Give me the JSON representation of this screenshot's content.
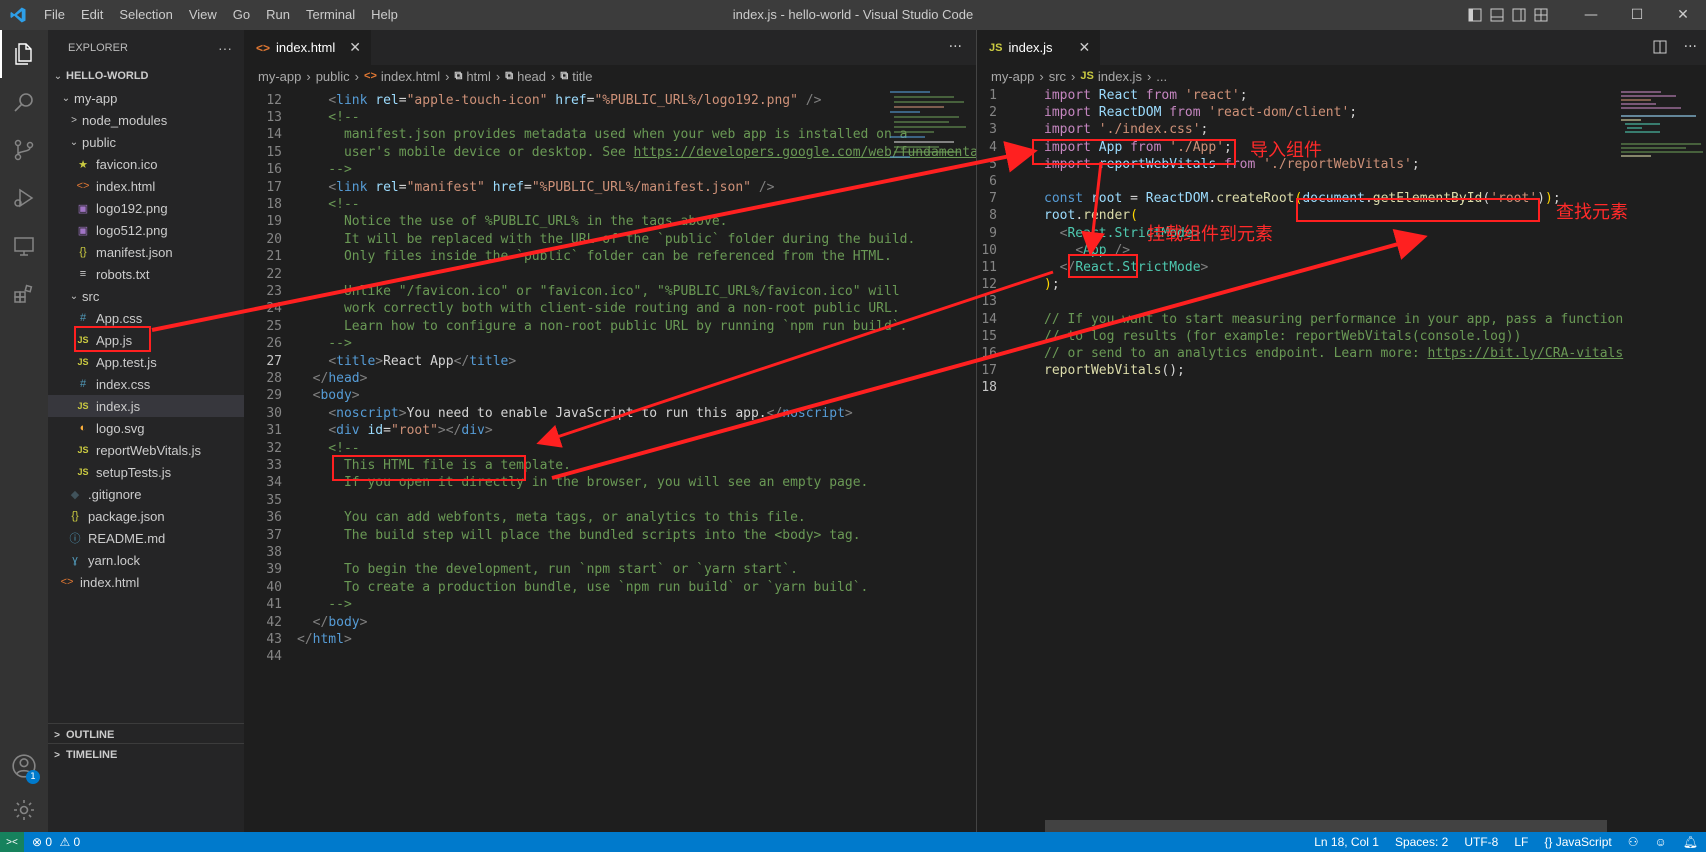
{
  "window": {
    "title": "index.js - hello-world - Visual Studio Code",
    "menu": [
      "File",
      "Edit",
      "Selection",
      "View",
      "Go",
      "Run",
      "Terminal",
      "Help"
    ],
    "controls": {
      "minimize": "—",
      "maximize": "☐",
      "close": "✕"
    }
  },
  "activity_bar": [
    "explorer-icon",
    "search-icon",
    "source-control-icon",
    "run-debug-icon",
    "remote-explorer-icon",
    "extensions-icon"
  ],
  "sidebar": {
    "header": "EXPLORER",
    "more": "···",
    "root": "HELLO-WORLD",
    "tree": [
      {
        "label": "my-app",
        "kind": "folder-open",
        "indent": 1
      },
      {
        "label": "node_modules",
        "kind": "folder-closed",
        "indent": 2
      },
      {
        "label": "public",
        "kind": "folder-open",
        "indent": 2
      },
      {
        "label": "favicon.ico",
        "kind": "star",
        "indent": 3
      },
      {
        "label": "index.html",
        "kind": "html",
        "indent": 3
      },
      {
        "label": "logo192.png",
        "kind": "image",
        "indent": 3
      },
      {
        "label": "logo512.png",
        "kind": "image",
        "indent": 3
      },
      {
        "label": "manifest.json",
        "kind": "json",
        "indent": 3
      },
      {
        "label": "robots.txt",
        "kind": "text",
        "indent": 3
      },
      {
        "label": "src",
        "kind": "folder-open",
        "indent": 2
      },
      {
        "label": "App.css",
        "kind": "css",
        "indent": 3
      },
      {
        "label": "App.js",
        "kind": "js",
        "indent": 3
      },
      {
        "label": "App.test.js",
        "kind": "js",
        "indent": 3
      },
      {
        "label": "index.css",
        "kind": "css",
        "indent": 3
      },
      {
        "label": "index.js",
        "kind": "js",
        "indent": 3,
        "selected": true
      },
      {
        "label": "logo.svg",
        "kind": "svg",
        "indent": 3
      },
      {
        "label": "reportWebVitals.js",
        "kind": "js",
        "indent": 3
      },
      {
        "label": "setupTests.js",
        "kind": "js",
        "indent": 3
      },
      {
        "label": ".gitignore",
        "kind": "git",
        "indent": 2
      },
      {
        "label": "package.json",
        "kind": "json",
        "indent": 2
      },
      {
        "label": "README.md",
        "kind": "info",
        "indent": 2
      },
      {
        "label": "yarn.lock",
        "kind": "yarn",
        "indent": 2
      },
      {
        "label": "index.html",
        "kind": "html",
        "indent": 1
      }
    ],
    "outline": "OUTLINE",
    "timeline": "TIMELINE",
    "account_badge": "1"
  },
  "left_editor": {
    "tab": "index.html",
    "tab_close": "✕",
    "more": "···",
    "breadcrumb": [
      "my-app",
      "public",
      "index.html",
      "html",
      "head",
      "title"
    ],
    "lines": [
      {
        "n": "12",
        "t": [
          [
            "    ",
            ""
          ],
          [
            "<",
            "pun"
          ],
          [
            "link",
            "tag"
          ],
          [
            " rel",
            "attr"
          ],
          [
            "=",
            ""
          ],
          [
            "\"apple-touch-icon\"",
            "str"
          ],
          [
            " href",
            "attr"
          ],
          [
            "=",
            ""
          ],
          [
            "\"%PUBLIC_URL%/logo192.png\"",
            "str"
          ],
          [
            " />",
            "pun"
          ]
        ]
      },
      {
        "n": "13",
        "t": [
          [
            "    <!--",
            "com"
          ]
        ]
      },
      {
        "n": "14",
        "t": [
          [
            "      manifest.json provides metadata used when your web app is installed on a",
            "com"
          ]
        ]
      },
      {
        "n": "15",
        "t": [
          [
            "      user's mobile device or desktop. See ",
            "com"
          ],
          [
            "https://developers.google.com/web/fundamentals/web-app-manifest/",
            "link"
          ]
        ]
      },
      {
        "n": "16",
        "t": [
          [
            "    -->",
            "com"
          ]
        ]
      },
      {
        "n": "17",
        "t": [
          [
            "    ",
            ""
          ],
          [
            "<",
            "pun"
          ],
          [
            "link",
            "tag"
          ],
          [
            " rel",
            "attr"
          ],
          [
            "=",
            ""
          ],
          [
            "\"manifest\"",
            "str"
          ],
          [
            " href",
            "attr"
          ],
          [
            "=",
            ""
          ],
          [
            "\"%PUBLIC_URL%/manifest.json\"",
            "str"
          ],
          [
            " />",
            "pun"
          ]
        ]
      },
      {
        "n": "18",
        "t": [
          [
            "    <!--",
            "com"
          ]
        ]
      },
      {
        "n": "19",
        "t": [
          [
            "      Notice the use of %PUBLIC_URL% in the tags above.",
            "com"
          ]
        ]
      },
      {
        "n": "20",
        "t": [
          [
            "      It will be replaced with the URL of the `public` folder during the build.",
            "com"
          ]
        ]
      },
      {
        "n": "21",
        "t": [
          [
            "      Only files inside the `public` folder can be referenced from the HTML.",
            "com"
          ]
        ]
      },
      {
        "n": "22",
        "t": [
          [
            "",
            ""
          ]
        ]
      },
      {
        "n": "23",
        "t": [
          [
            "      Unlike \"/favicon.ico\" or \"favicon.ico\", \"%PUBLIC_URL%/favicon.ico\" will",
            "com"
          ]
        ]
      },
      {
        "n": "24",
        "t": [
          [
            "      work correctly both with client-side routing and a non-root public URL.",
            "com"
          ]
        ]
      },
      {
        "n": "25",
        "t": [
          [
            "      Learn how to configure a non-root public URL by running `npm run build`.",
            "com"
          ]
        ]
      },
      {
        "n": "26",
        "t": [
          [
            "    -->",
            "com"
          ]
        ]
      },
      {
        "n": "27",
        "t": [
          [
            "    ",
            ""
          ],
          [
            "<",
            "pun"
          ],
          [
            "title",
            "tag"
          ],
          [
            ">",
            "pun"
          ],
          [
            "React App",
            ""
          ],
          [
            "</",
            "pun"
          ],
          [
            "title",
            "tag"
          ],
          [
            ">",
            "pun"
          ]
        ],
        "cur": true
      },
      {
        "n": "28",
        "t": [
          [
            "  ",
            ""
          ],
          [
            "</",
            "pun"
          ],
          [
            "head",
            "tag"
          ],
          [
            ">",
            "pun"
          ]
        ]
      },
      {
        "n": "29",
        "t": [
          [
            "  ",
            ""
          ],
          [
            "<",
            "pun"
          ],
          [
            "body",
            "tag"
          ],
          [
            ">",
            "pun"
          ]
        ]
      },
      {
        "n": "30",
        "t": [
          [
            "    ",
            ""
          ],
          [
            "<",
            "pun"
          ],
          [
            "noscript",
            "tag"
          ],
          [
            ">",
            "pun"
          ],
          [
            "You need to enable JavaScript to run this app.",
            ""
          ],
          [
            "</",
            "pun"
          ],
          [
            "noscript",
            "tag"
          ],
          [
            ">",
            "pun"
          ]
        ]
      },
      {
        "n": "31",
        "t": [
          [
            "    ",
            ""
          ],
          [
            "<",
            "pun"
          ],
          [
            "div",
            "tag"
          ],
          [
            " id",
            "attr"
          ],
          [
            "=",
            ""
          ],
          [
            "\"root\"",
            "str"
          ],
          [
            ">",
            "pun"
          ],
          [
            "</",
            "pun"
          ],
          [
            "div",
            "tag"
          ],
          [
            ">",
            "pun"
          ]
        ]
      },
      {
        "n": "32",
        "t": [
          [
            "    <!--",
            "com"
          ]
        ]
      },
      {
        "n": "33",
        "t": [
          [
            "      This HTML file is a template.",
            "com"
          ]
        ]
      },
      {
        "n": "34",
        "t": [
          [
            "      If you open it directly in the browser, you will see an empty page.",
            "com"
          ]
        ]
      },
      {
        "n": "35",
        "t": [
          [
            "",
            ""
          ]
        ]
      },
      {
        "n": "36",
        "t": [
          [
            "      You can add webfonts, meta tags, or analytics to this file.",
            "com"
          ]
        ]
      },
      {
        "n": "37",
        "t": [
          [
            "      The build step will place the bundled scripts into the <body> tag.",
            "com"
          ]
        ]
      },
      {
        "n": "38",
        "t": [
          [
            "",
            ""
          ]
        ]
      },
      {
        "n": "39",
        "t": [
          [
            "      To begin the development, run `npm start` or `yarn start`.",
            "com"
          ]
        ]
      },
      {
        "n": "40",
        "t": [
          [
            "      To create a production bundle, use `npm run build` or `yarn build`.",
            "com"
          ]
        ]
      },
      {
        "n": "41",
        "t": [
          [
            "    -->",
            "com"
          ]
        ]
      },
      {
        "n": "42",
        "t": [
          [
            "  ",
            ""
          ],
          [
            "</",
            "pun"
          ],
          [
            "body",
            "tag"
          ],
          [
            ">",
            "pun"
          ]
        ]
      },
      {
        "n": "43",
        "t": [
          [
            "",
            ""
          ],
          [
            "</",
            "pun"
          ],
          [
            "html",
            "tag"
          ],
          [
            ">",
            "pun"
          ]
        ]
      },
      {
        "n": "44",
        "t": [
          [
            "",
            ""
          ]
        ]
      }
    ]
  },
  "right_editor": {
    "tab": "index.js",
    "tab_close": "✕",
    "more": "···",
    "breadcrumb": [
      "my-app",
      "src",
      "index.js",
      "..."
    ],
    "lines": [
      {
        "n": "1",
        "t": [
          [
            "import",
            "kw"
          ],
          [
            " React ",
            "var"
          ],
          [
            "from",
            "kw"
          ],
          [
            " 'react'",
            "str"
          ],
          [
            ";",
            ""
          ]
        ]
      },
      {
        "n": "2",
        "t": [
          [
            "import",
            "kw"
          ],
          [
            " ReactDOM ",
            "var"
          ],
          [
            "from",
            "kw"
          ],
          [
            " 'react-dom/client'",
            "str"
          ],
          [
            ";",
            ""
          ]
        ]
      },
      {
        "n": "3",
        "t": [
          [
            "import",
            "kw"
          ],
          [
            " './index.css'",
            "str"
          ],
          [
            ";",
            ""
          ]
        ]
      },
      {
        "n": "4",
        "t": [
          [
            "import",
            "kw"
          ],
          [
            " App ",
            "var"
          ],
          [
            "from",
            "kw"
          ],
          [
            " './App'",
            "str"
          ],
          [
            ";",
            ""
          ]
        ]
      },
      {
        "n": "5",
        "t": [
          [
            "import",
            "kw"
          ],
          [
            " reportWebVitals ",
            "var"
          ],
          [
            "from",
            "kw"
          ],
          [
            " './reportWebVitals'",
            "str"
          ],
          [
            ";",
            ""
          ]
        ]
      },
      {
        "n": "6",
        "t": [
          [
            "",
            ""
          ]
        ]
      },
      {
        "n": "7",
        "t": [
          [
            "const",
            "dec"
          ],
          [
            " root ",
            "var"
          ],
          [
            "= ",
            ""
          ],
          [
            "ReactDOM",
            "var"
          ],
          [
            ".",
            ""
          ],
          [
            "createRoot",
            "fn"
          ],
          [
            "(",
            "brk"
          ],
          [
            "document",
            "var"
          ],
          [
            ".",
            ""
          ],
          [
            "getElementById",
            "fn"
          ],
          [
            "(",
            ""
          ],
          [
            "'root'",
            "str"
          ],
          [
            ")",
            ""
          ],
          [
            ")",
            "brk"
          ],
          [
            ";",
            ""
          ]
        ]
      },
      {
        "n": "8",
        "t": [
          [
            "root",
            "var"
          ],
          [
            ".",
            ""
          ],
          [
            "render",
            "fn"
          ],
          [
            "(",
            "brk"
          ]
        ]
      },
      {
        "n": "9",
        "t": [
          [
            "  ",
            ""
          ],
          [
            "<",
            "pun"
          ],
          [
            "React.StrictMode",
            "cls"
          ],
          [
            ">",
            "pun"
          ]
        ]
      },
      {
        "n": "10",
        "t": [
          [
            "    ",
            ""
          ],
          [
            "<",
            "pun"
          ],
          [
            "App",
            "cls"
          ],
          [
            " />",
            "pun"
          ]
        ]
      },
      {
        "n": "11",
        "t": [
          [
            "  ",
            ""
          ],
          [
            "</",
            "pun"
          ],
          [
            "React.StrictMode",
            "cls"
          ],
          [
            ">",
            "pun"
          ]
        ]
      },
      {
        "n": "12",
        "t": [
          [
            ")",
            "brk"
          ],
          [
            ";",
            ""
          ]
        ]
      },
      {
        "n": "13",
        "t": [
          [
            "",
            ""
          ]
        ]
      },
      {
        "n": "14",
        "t": [
          [
            "// If you want to start measuring performance in your app, pass a function",
            "com"
          ]
        ]
      },
      {
        "n": "15",
        "t": [
          [
            "// to log results (for example: reportWebVitals(console.log))",
            "com"
          ]
        ]
      },
      {
        "n": "16",
        "t": [
          [
            "// or send to an analytics endpoint. Learn more: ",
            "com"
          ],
          [
            "https://bit.ly/CRA-vitals",
            "link"
          ]
        ]
      },
      {
        "n": "17",
        "t": [
          [
            "reportWebVitals",
            "fn"
          ],
          [
            "();",
            ""
          ]
        ]
      },
      {
        "n": "18",
        "t": [
          [
            "",
            ""
          ]
        ],
        "cur": true
      }
    ]
  },
  "annotations": {
    "import_component": "导入组件",
    "find_element": "查找元素",
    "mount_component": "挂载组件到元素"
  },
  "status": {
    "errors": "0",
    "warnings": "0",
    "position": "Ln 18, Col 1",
    "spaces": "Spaces: 2",
    "encoding": "UTF-8",
    "eol": "LF",
    "language": "JavaScript"
  },
  "colors": {
    "accent": "#007acc",
    "annotation": "#ff2020"
  }
}
